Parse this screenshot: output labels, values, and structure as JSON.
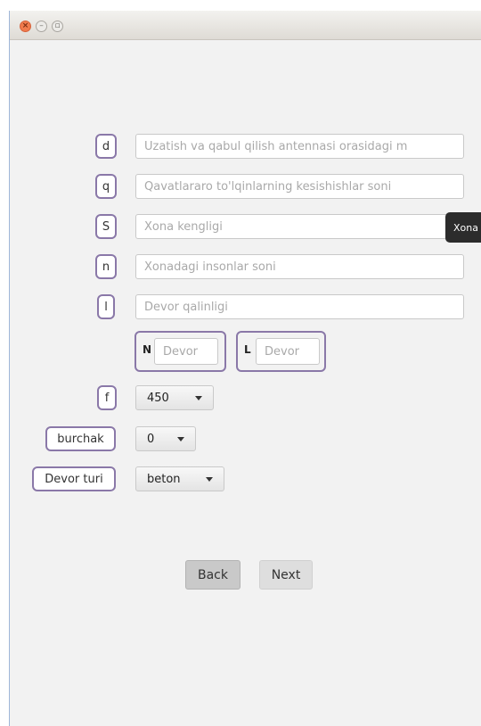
{
  "window": {
    "controls": {
      "close": "×",
      "minimize": "–",
      "maximize": "▫"
    }
  },
  "form": {
    "rows": [
      {
        "label": "d",
        "placeholder": "Uzatish va qabul qilish antennasi orasidagi m"
      },
      {
        "label": "q",
        "placeholder": "Qavatlararo to'lqinlarning kesishishlar soni"
      },
      {
        "label": "S",
        "placeholder": "Xona kengligi"
      },
      {
        "label": "n",
        "placeholder": "Xonadagi insonlar soni"
      },
      {
        "label": "l",
        "placeholder": "Devor qalinligi"
      }
    ],
    "wall_groups": [
      {
        "label": "N",
        "placeholder": "Devor"
      },
      {
        "label": "L",
        "placeholder": "Devor"
      }
    ],
    "selects": [
      {
        "label": "f",
        "value": "450"
      },
      {
        "label": "burchak",
        "value": "0"
      },
      {
        "label": "Devor turi",
        "value": "beton"
      }
    ]
  },
  "buttons": {
    "back": "Back",
    "next": "Next"
  },
  "tooltip": {
    "text": "Xona kengligi"
  }
}
